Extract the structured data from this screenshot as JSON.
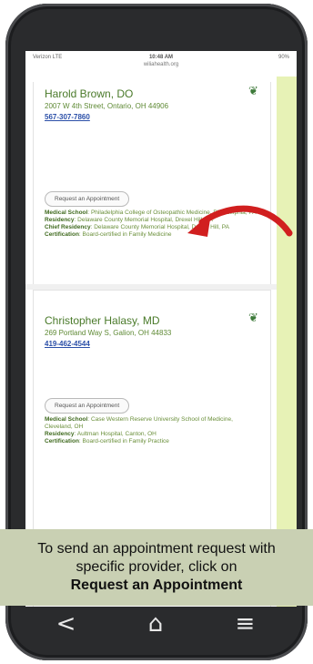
{
  "status_bar": {
    "carrier": "Verizon LTE",
    "time": "10:48 AM",
    "battery": "90%"
  },
  "url": "wiliahealth.org",
  "providers": [
    {
      "name": "Harold Brown, DO",
      "address": "2007 W 4th Street, Ontario, OH 44906",
      "phone": "567-307-7860",
      "request_label": "Request an Appointment",
      "details": [
        {
          "label": "Medical School",
          "value": "Philadelphia College of Osteopathic Medicine, Philadelphia, PA"
        },
        {
          "label": "Residency",
          "value": "Delaware County Memorial Hospital, Drexel Hill, PA"
        },
        {
          "label": "Chief Residency",
          "value": "Delaware County Memorial Hospital, Drexel Hill, PA"
        },
        {
          "label": "Certification",
          "value": "Board-certified in Family Medicine"
        }
      ]
    },
    {
      "name": "Christopher Halasy, MD",
      "address": "269 Portland Way S, Galion, OH 44833",
      "phone": "419-462-4544",
      "request_label": "Request an Appointment",
      "details": [
        {
          "label": "Medical School",
          "value": "Case Western Reserve University School of Medicine, Cleveland, OH"
        },
        {
          "label": "Residency",
          "value": "Aultman Hospital, Canton, OH"
        },
        {
          "label": "Certification",
          "value": "Board-certified in Family Practice"
        }
      ]
    }
  ],
  "caption": {
    "line1": "To send an appointment request with",
    "line2": "specific provider, click on",
    "line3": "Request an Appointment"
  },
  "nav": {
    "back_icon": "back-chevron-icon",
    "home_icon": "home-icon",
    "menu_icon": "menu-icon"
  },
  "colors": {
    "accent_arrow": "#d11f1f",
    "caption_bg": "#c9d0b3",
    "name_green": "#4a7a2a"
  }
}
